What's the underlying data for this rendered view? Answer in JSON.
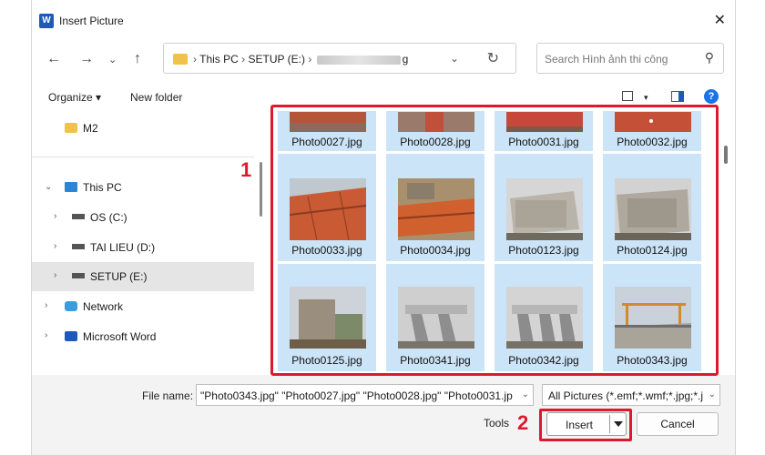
{
  "window": {
    "title": "Insert Picture",
    "app_icon": "word-icon"
  },
  "address": {
    "crumbs": [
      "This PC",
      "SETUP (E:)"
    ],
    "last_crumb_tail": "g",
    "search_placeholder": "Search Hình ảnh thi công"
  },
  "toolbar": {
    "organize": "Organize ▾",
    "new_folder": "New folder"
  },
  "sidebar": {
    "items": [
      {
        "label": "M2",
        "icon": "folder-icon"
      },
      {
        "label": "This PC",
        "icon": "computer-icon"
      },
      {
        "label": "OS (C:)",
        "icon": "drive-icon"
      },
      {
        "label": "TAI LIEU (D:)",
        "icon": "drive-icon"
      },
      {
        "label": "SETUP (E:)",
        "icon": "drive-icon",
        "selected": true
      },
      {
        "label": "Network",
        "icon": "network-icon"
      },
      {
        "label": "Microsoft Word",
        "icon": "word-icon"
      }
    ]
  },
  "files": [
    {
      "name": "Photo0027.jpg",
      "scene": "red"
    },
    {
      "name": "Photo0028.jpg",
      "scene": "red"
    },
    {
      "name": "Photo0031.jpg",
      "scene": "red"
    },
    {
      "name": "Photo0032.jpg",
      "scene": "red"
    },
    {
      "name": "Photo0033.jpg",
      "scene": "red"
    },
    {
      "name": "Photo0034.jpg",
      "scene": "red"
    },
    {
      "name": "Photo0123.jpg",
      "scene": "concrete"
    },
    {
      "name": "Photo0124.jpg",
      "scene": "concrete"
    },
    {
      "name": "Photo0125.jpg",
      "scene": "concrete"
    },
    {
      "name": "Photo0341.jpg",
      "scene": "girder"
    },
    {
      "name": "Photo0342.jpg",
      "scene": "girder"
    },
    {
      "name": "Photo0343.jpg",
      "scene": "bridge"
    }
  ],
  "annotations": {
    "label_1": "1",
    "label_2": "2",
    "color": "#e0182d"
  },
  "footer": {
    "file_name_label": "File name:",
    "file_name_value": "\"Photo0343.jpg\" \"Photo0027.jpg\" \"Photo0028.jpg\" \"Photo0031.jp",
    "filter_value": "All Pictures (*.emf;*.wmf;*.jpg;*.j",
    "tools_label": "Tools",
    "insert_label": "Insert",
    "cancel_label": "Cancel"
  },
  "colors": {
    "selection": "#cce4f7",
    "accent": "#1a73e8"
  }
}
